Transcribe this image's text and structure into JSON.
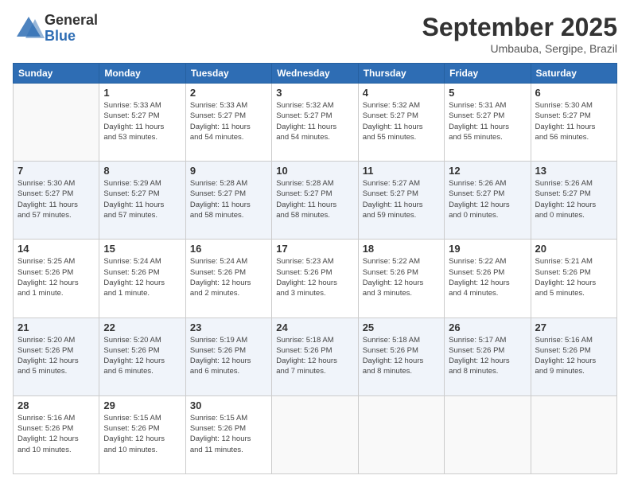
{
  "logo": {
    "general": "General",
    "blue": "Blue"
  },
  "header": {
    "month": "September 2025",
    "location": "Umbauba, Sergipe, Brazil"
  },
  "weekdays": [
    "Sunday",
    "Monday",
    "Tuesday",
    "Wednesday",
    "Thursday",
    "Friday",
    "Saturday"
  ],
  "weeks": [
    [
      {
        "day": "",
        "info": ""
      },
      {
        "day": "1",
        "info": "Sunrise: 5:33 AM\nSunset: 5:27 PM\nDaylight: 11 hours\nand 53 minutes."
      },
      {
        "day": "2",
        "info": "Sunrise: 5:33 AM\nSunset: 5:27 PM\nDaylight: 11 hours\nand 54 minutes."
      },
      {
        "day": "3",
        "info": "Sunrise: 5:32 AM\nSunset: 5:27 PM\nDaylight: 11 hours\nand 54 minutes."
      },
      {
        "day": "4",
        "info": "Sunrise: 5:32 AM\nSunset: 5:27 PM\nDaylight: 11 hours\nand 55 minutes."
      },
      {
        "day": "5",
        "info": "Sunrise: 5:31 AM\nSunset: 5:27 PM\nDaylight: 11 hours\nand 55 minutes."
      },
      {
        "day": "6",
        "info": "Sunrise: 5:30 AM\nSunset: 5:27 PM\nDaylight: 11 hours\nand 56 minutes."
      }
    ],
    [
      {
        "day": "7",
        "info": "Sunrise: 5:30 AM\nSunset: 5:27 PM\nDaylight: 11 hours\nand 57 minutes."
      },
      {
        "day": "8",
        "info": "Sunrise: 5:29 AM\nSunset: 5:27 PM\nDaylight: 11 hours\nand 57 minutes."
      },
      {
        "day": "9",
        "info": "Sunrise: 5:28 AM\nSunset: 5:27 PM\nDaylight: 11 hours\nand 58 minutes."
      },
      {
        "day": "10",
        "info": "Sunrise: 5:28 AM\nSunset: 5:27 PM\nDaylight: 11 hours\nand 58 minutes."
      },
      {
        "day": "11",
        "info": "Sunrise: 5:27 AM\nSunset: 5:27 PM\nDaylight: 11 hours\nand 59 minutes."
      },
      {
        "day": "12",
        "info": "Sunrise: 5:26 AM\nSunset: 5:27 PM\nDaylight: 12 hours\nand 0 minutes."
      },
      {
        "day": "13",
        "info": "Sunrise: 5:26 AM\nSunset: 5:27 PM\nDaylight: 12 hours\nand 0 minutes."
      }
    ],
    [
      {
        "day": "14",
        "info": "Sunrise: 5:25 AM\nSunset: 5:26 PM\nDaylight: 12 hours\nand 1 minute."
      },
      {
        "day": "15",
        "info": "Sunrise: 5:24 AM\nSunset: 5:26 PM\nDaylight: 12 hours\nand 1 minute."
      },
      {
        "day": "16",
        "info": "Sunrise: 5:24 AM\nSunset: 5:26 PM\nDaylight: 12 hours\nand 2 minutes."
      },
      {
        "day": "17",
        "info": "Sunrise: 5:23 AM\nSunset: 5:26 PM\nDaylight: 12 hours\nand 3 minutes."
      },
      {
        "day": "18",
        "info": "Sunrise: 5:22 AM\nSunset: 5:26 PM\nDaylight: 12 hours\nand 3 minutes."
      },
      {
        "day": "19",
        "info": "Sunrise: 5:22 AM\nSunset: 5:26 PM\nDaylight: 12 hours\nand 4 minutes."
      },
      {
        "day": "20",
        "info": "Sunrise: 5:21 AM\nSunset: 5:26 PM\nDaylight: 12 hours\nand 5 minutes."
      }
    ],
    [
      {
        "day": "21",
        "info": "Sunrise: 5:20 AM\nSunset: 5:26 PM\nDaylight: 12 hours\nand 5 minutes."
      },
      {
        "day": "22",
        "info": "Sunrise: 5:20 AM\nSunset: 5:26 PM\nDaylight: 12 hours\nand 6 minutes."
      },
      {
        "day": "23",
        "info": "Sunrise: 5:19 AM\nSunset: 5:26 PM\nDaylight: 12 hours\nand 6 minutes."
      },
      {
        "day": "24",
        "info": "Sunrise: 5:18 AM\nSunset: 5:26 PM\nDaylight: 12 hours\nand 7 minutes."
      },
      {
        "day": "25",
        "info": "Sunrise: 5:18 AM\nSunset: 5:26 PM\nDaylight: 12 hours\nand 8 minutes."
      },
      {
        "day": "26",
        "info": "Sunrise: 5:17 AM\nSunset: 5:26 PM\nDaylight: 12 hours\nand 8 minutes."
      },
      {
        "day": "27",
        "info": "Sunrise: 5:16 AM\nSunset: 5:26 PM\nDaylight: 12 hours\nand 9 minutes."
      }
    ],
    [
      {
        "day": "28",
        "info": "Sunrise: 5:16 AM\nSunset: 5:26 PM\nDaylight: 12 hours\nand 10 minutes."
      },
      {
        "day": "29",
        "info": "Sunrise: 5:15 AM\nSunset: 5:26 PM\nDaylight: 12 hours\nand 10 minutes."
      },
      {
        "day": "30",
        "info": "Sunrise: 5:15 AM\nSunset: 5:26 PM\nDaylight: 12 hours\nand 11 minutes."
      },
      {
        "day": "",
        "info": ""
      },
      {
        "day": "",
        "info": ""
      },
      {
        "day": "",
        "info": ""
      },
      {
        "day": "",
        "info": ""
      }
    ]
  ]
}
